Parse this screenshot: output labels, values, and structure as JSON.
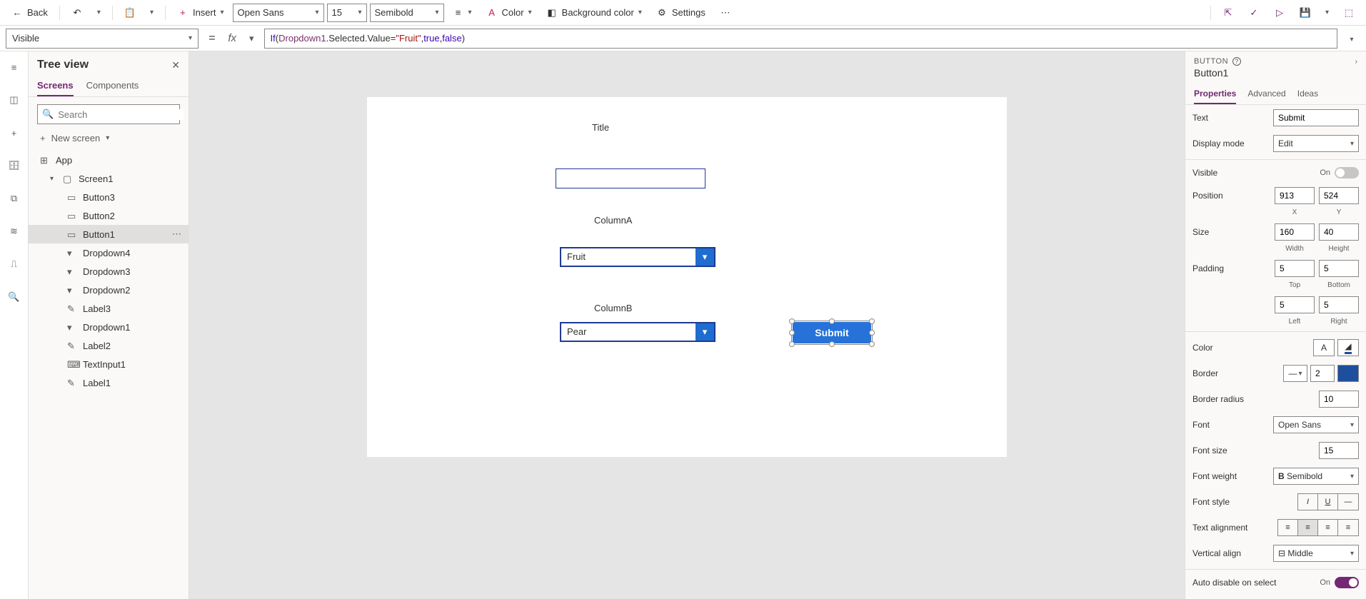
{
  "toolbar": {
    "back_label": "Back",
    "insert_label": "Insert",
    "font_family": "Open Sans",
    "font_size": "15",
    "font_weight": "Semibold",
    "color_label": "Color",
    "bg_label": "Background color",
    "settings_label": "Settings"
  },
  "formula": {
    "property": "Visible",
    "fx": "fx",
    "expr_if": "If",
    "expr_ident": "Dropdown1",
    "expr_rest1": ".Selected.Value=",
    "expr_str": "\"Fruit\"",
    "expr_rest2": ",",
    "expr_true": "true",
    "expr_rest3": ",",
    "expr_false": "false",
    "expr_rest4": ")"
  },
  "tree": {
    "title": "Tree view",
    "tab_screens": "Screens",
    "tab_components": "Components",
    "search_placeholder": "Search",
    "new_screen": "New screen",
    "items": [
      {
        "label": "App",
        "lvl": 1,
        "icon": "app"
      },
      {
        "label": "Screen1",
        "lvl": 2,
        "icon": "screen",
        "expand": true
      },
      {
        "label": "Button3",
        "lvl": 3,
        "icon": "button"
      },
      {
        "label": "Button2",
        "lvl": 3,
        "icon": "button"
      },
      {
        "label": "Button1",
        "lvl": 3,
        "icon": "button",
        "selected": true
      },
      {
        "label": "Dropdown4",
        "lvl": 3,
        "icon": "dropdown"
      },
      {
        "label": "Dropdown3",
        "lvl": 3,
        "icon": "dropdown"
      },
      {
        "label": "Dropdown2",
        "lvl": 3,
        "icon": "dropdown"
      },
      {
        "label": "Label3",
        "lvl": 3,
        "icon": "label"
      },
      {
        "label": "Dropdown1",
        "lvl": 3,
        "icon": "dropdown"
      },
      {
        "label": "Label2",
        "lvl": 3,
        "icon": "label"
      },
      {
        "label": "TextInput1",
        "lvl": 3,
        "icon": "textinput"
      },
      {
        "label": "Label1",
        "lvl": 3,
        "icon": "label"
      }
    ]
  },
  "canvas": {
    "title": "Title",
    "columnA": "ColumnA",
    "columnB": "ColumnB",
    "dropdownA_value": "Fruit",
    "dropdownB_value": "Pear",
    "submit": "Submit"
  },
  "props": {
    "type": "BUTTON",
    "name": "Button1",
    "tab_props": "Properties",
    "tab_adv": "Advanced",
    "tab_ideas": "Ideas",
    "text_label": "Text",
    "text_value": "Submit",
    "display_mode_label": "Display mode",
    "display_mode_value": "Edit",
    "visible_label": "Visible",
    "visible_on": "On",
    "position_label": "Position",
    "pos_x": "913",
    "pos_y": "524",
    "pos_x_label": "X",
    "pos_y_label": "Y",
    "size_label": "Size",
    "size_w": "160",
    "size_h": "40",
    "size_w_label": "Width",
    "size_h_label": "Height",
    "padding_label": "Padding",
    "pad_top": "5",
    "pad_bottom": "5",
    "pad_top_label": "Top",
    "pad_bottom_label": "Bottom",
    "pad_left": "5",
    "pad_right": "5",
    "pad_left_label": "Left",
    "pad_right_label": "Right",
    "color_label": "Color",
    "border_label": "Border",
    "border_width": "2",
    "border_color": "#1f4e9c",
    "radius_label": "Border radius",
    "radius_value": "10",
    "font_label": "Font",
    "font_value": "Open Sans",
    "fontsize_label": "Font size",
    "fontsize_value": "15",
    "fontweight_label": "Font weight",
    "fontweight_value": "Semibold",
    "fontstyle_label": "Font style",
    "textalign_label": "Text alignment",
    "valign_label": "Vertical align",
    "valign_value": "Middle",
    "autodisable_label": "Auto disable on select",
    "autodisable_on": "On"
  }
}
